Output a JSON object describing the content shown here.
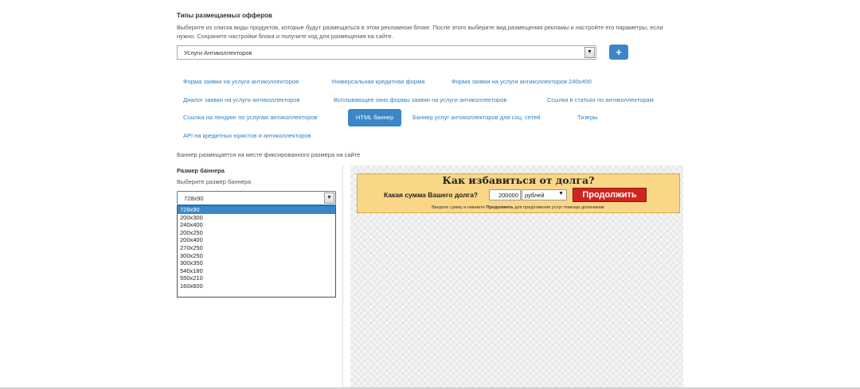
{
  "offers": {
    "title": "Типы размещаемых офферов",
    "description": "Выберите из списка виды продуктов, которые будут размещаться в этом рекламном блоке. После этого выберите вид размещения рекламы и настройте его параметры, если нужно. Сохраните настройки блока и получите код для размещения на сайте.",
    "selected_offer": "Услуги Антиколлекторов",
    "add_button_label": "+"
  },
  "placement_tabs": [
    "Форма заявки на услуги антиколлекторов",
    "Универсальная кредитная форма",
    "Форма заявки на услуги антиколлекторов 240x400",
    "Диалог заявки на услуги антиколлекторов",
    "Всплывающее окно формы заявки на услуги антиколлекторов",
    "Ссылки в статьях по антиколлекторам",
    "Ссылка на лендинг по услугам антиколлекторов",
    "HTML баннер",
    "Баннер услуг антиколлекторов для соц. сетей",
    "Тизеры",
    "API на кредитных юристов и антиколлекторов"
  ],
  "active_tab_index": 7,
  "banner_note": "Баннер размещается на месте фиксированного размера на сайте",
  "banner_size": {
    "title": "Размер баннера",
    "hint": "Выберите размер баннера",
    "selected": "728x90",
    "options": [
      "728x90",
      "200x300",
      "240x400",
      "200x250",
      "200x400",
      "270x250",
      "300x250",
      "300x350",
      "540x180",
      "550x210",
      "160x600"
    ]
  },
  "ad_preview": {
    "title": "Как избавиться от долга?",
    "question": "Какая сумма Вашего долга?",
    "amount": "200000",
    "currency": "рублей",
    "continue_label": "Продолжить",
    "footnote_before": "Введите сумму и нажмите",
    "footnote_bold": "Продолжить",
    "footnote_after": "для предложения услуг помощи должникам."
  },
  "colors": {
    "accent": "#3a86c8",
    "link": "#2f7fc1",
    "banner_bg": "#f9d787",
    "continue_button": "#d3231f"
  }
}
